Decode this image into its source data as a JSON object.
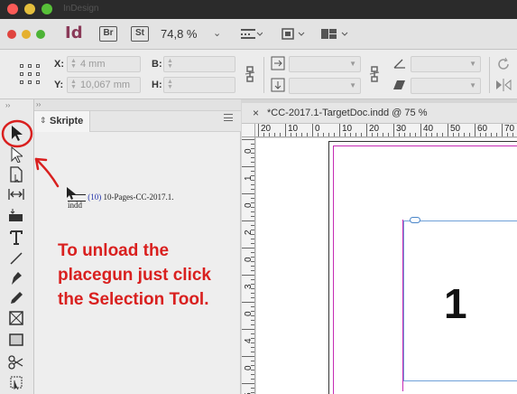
{
  "window": {
    "title": "InDesign"
  },
  "appbar": {
    "app_logo": "Id",
    "bridge_label": "Br",
    "stock_label": "St",
    "zoom": "74,8 %",
    "icons": [
      "view-options-icon",
      "screen-mode-icon",
      "arrange-documents-icon"
    ]
  },
  "control": {
    "x_label": "X:",
    "x_value": "4 mm",
    "y_label": "Y:",
    "y_value": "10,067 mm",
    "b_label": "B:",
    "h_label": "H:"
  },
  "panel": {
    "tab_label": "Skripte",
    "placegun_count": "(10)",
    "placegun_file_line1": "10-Pages-CC-2017.1.",
    "placegun_file_line2": "indd"
  },
  "annotation": {
    "line1": "To unload the",
    "line2": "placegun just click",
    "line3": "the Selection Tool."
  },
  "document": {
    "tab_title": "*CC-2017.1-TargetDoc.indd @ 75 %",
    "close_glyph": "×",
    "page_number": "1",
    "hruler_labels": [
      "20",
      "10",
      "0",
      "10",
      "20",
      "30",
      "40",
      "50",
      "60",
      "70"
    ],
    "vruler_labels": [
      "0",
      "1",
      "0",
      "2",
      "0",
      "3",
      "0",
      "4",
      "0",
      "5"
    ]
  },
  "tools": [
    "selection-tool-icon",
    "direct-selection-tool-icon",
    "page-tool-icon",
    "gap-tool-icon",
    "content-collector-icon",
    "type-tool-icon",
    "line-tool-icon",
    "pen-tool-icon",
    "pencil-tool-icon",
    "rectangle-frame-tool-icon",
    "rectangle-tool-icon",
    "scissors-tool-icon",
    "free-transform-tool-icon"
  ],
  "colors": {
    "annotation_red": "#d9201f",
    "margin_guide": "#c42bb4",
    "frame_edge": "#6fa0d8",
    "indesign_brand": "#8a3a58"
  }
}
